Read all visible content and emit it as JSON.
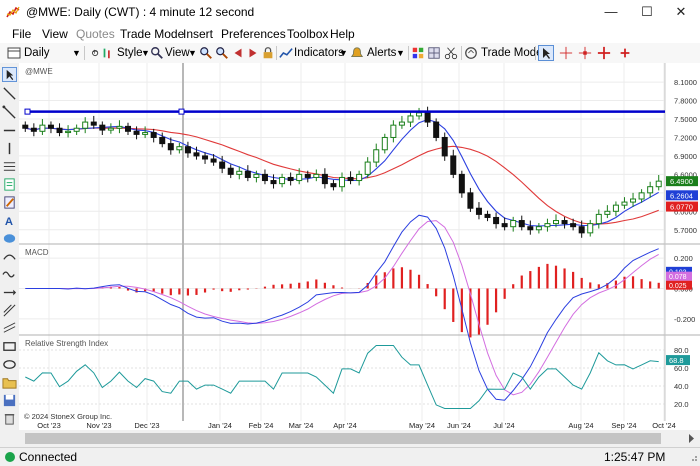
{
  "window": {
    "title": "@MWE: Daily (CWT) : 4 minute 12 second",
    "minimize_glyph": "—",
    "maximize_glyph": "☐",
    "close_glyph": "✕"
  },
  "menu": [
    "File",
    "View",
    "Quotes",
    "Trade Mode",
    "Insert",
    "Preferences",
    "Toolbox",
    "Help"
  ],
  "menu_disabled": [
    "Quotes"
  ],
  "toolbar": {
    "interval": "Daily",
    "style": "Style",
    "view": "View",
    "indicators": "Indicators",
    "alerts": "Alerts",
    "trade_mode": "Trade Mode"
  },
  "price_pane": {
    "label": "@MWE",
    "axis_ticks": [
      "8.1000",
      "7.8000",
      "7.5000",
      "7.2000",
      "6.9000",
      "6.6000",
      "6.3000",
      "6.0000",
      "5.7000"
    ],
    "tags": [
      {
        "value": "6.4900",
        "color": "#1a7f1a"
      },
      {
        "value": "6.2604",
        "color": "#1f3fd6"
      },
      {
        "value": "6.0770",
        "color": "#e02020"
      }
    ],
    "hline_value": 7.62,
    "hline_color": "#0000cc"
  },
  "macd_pane": {
    "label": "MACD",
    "axis_ticks": [
      "0.200",
      "0.000",
      "-0.200"
    ],
    "tags": [
      {
        "value": "0.103",
        "color": "#1f3fd6"
      },
      {
        "value": "0.078",
        "color": "#d36ee0"
      },
      {
        "value": "0.025",
        "color": "#e02020"
      }
    ]
  },
  "rsi_pane": {
    "label": "Relative Strength Index",
    "axis_ticks": [
      "80.0",
      "60.0",
      "40.0",
      "20.0"
    ],
    "tag": {
      "value": "68.8",
      "color": "#1e9a9a"
    },
    "copyright": "© 2024 StoneX Group Inc."
  },
  "x_axis": {
    "labels": [
      "Oct '23",
      "Nov '23",
      "Dec '23",
      "Jan '24",
      "Feb '24",
      "Mar '24",
      "Apr '24",
      "May '24",
      "Jun '24",
      "Jul '24",
      "Aug '24",
      "Sep '24",
      "Oct '24"
    ]
  },
  "status": {
    "connection": "Connected",
    "time": "1:25:47 PM"
  },
  "colors": {
    "up_candle": "#1a7f1a",
    "down_candle": "#111111",
    "ma_fast": "#2b3fe0",
    "ma_slow": "#e03a3a",
    "macd_line": "#2b3fe0",
    "signal_line": "#d36ee0",
    "histogram": "#e02020",
    "rsi": "#1e9a9a"
  },
  "icons": {
    "app": "chart-app-icon",
    "left_tools": [
      "pointer-icon",
      "line-tool-icon",
      "ray-tool-icon",
      "horizontal-line-icon",
      "vertical-line-icon",
      "fibonacci-icon",
      "text-tool-icon",
      "pencil-icon",
      "note-icon",
      "ellipse-icon",
      "arc-icon",
      "wave-icon",
      "crosshair-icon",
      "rectangle-icon",
      "oval-icon",
      "eraser-icon",
      "folder-icon",
      "save-icon",
      "delete-icon"
    ]
  },
  "chart_data": {
    "type": "candlestick",
    "series": [
      {
        "name": "@MWE",
        "close": [
          7.35,
          7.3,
          7.4,
          7.35,
          7.28,
          7.3,
          7.35,
          7.45,
          7.4,
          7.32,
          7.35,
          7.38,
          7.3,
          7.25,
          7.28,
          7.2,
          7.1,
          7.0,
          7.05,
          6.95,
          6.9,
          6.85,
          6.8,
          6.7,
          6.6,
          6.65,
          6.55,
          6.6,
          6.5,
          6.45,
          6.55,
          6.5,
          6.6,
          6.55,
          6.6,
          6.45,
          6.4,
          6.55,
          6.5,
          6.6,
          6.8,
          7.0,
          7.2,
          7.4,
          7.45,
          7.55,
          7.6,
          7.45,
          7.2,
          6.9,
          6.6,
          6.3,
          6.05,
          5.95,
          5.9,
          5.8,
          5.75,
          5.85,
          5.75,
          5.7,
          5.75,
          5.8,
          5.85,
          5.8,
          5.75,
          5.65,
          5.8,
          5.95,
          6.0,
          6.1,
          6.15,
          6.2,
          6.3,
          6.4,
          6.49
        ]
      }
    ],
    "ylim": [
      5.55,
      8.15
    ]
  }
}
